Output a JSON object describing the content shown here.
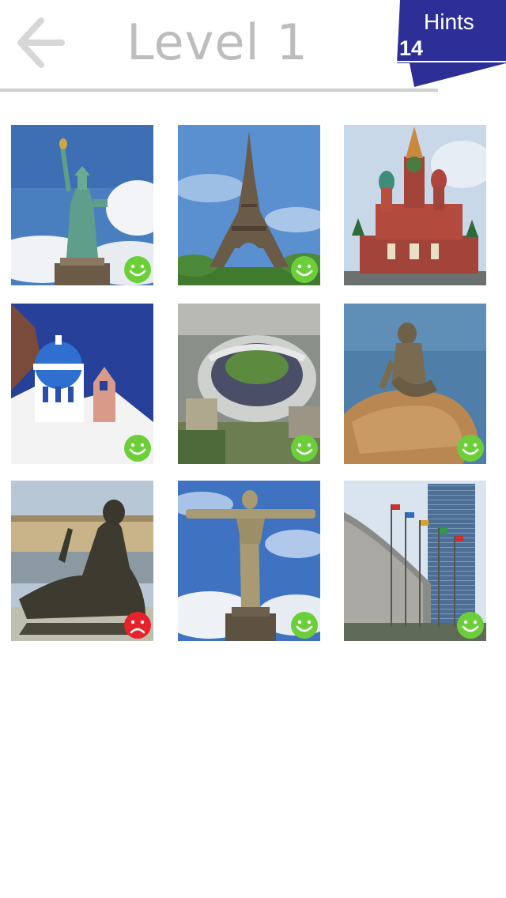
{
  "header": {
    "title": "Level 1",
    "hints_label": "Hints",
    "hints_count": "14"
  },
  "colors": {
    "hints_bg": "#2e2f96",
    "correct": "#6ccf3a",
    "wrong": "#e8222a",
    "title": "#bdbdbd"
  },
  "tiles": [
    {
      "name": "statue-of-liberty",
      "status": "correct"
    },
    {
      "name": "eiffel-tower",
      "status": "correct"
    },
    {
      "name": "saint-basils-cathedral",
      "status": "none"
    },
    {
      "name": "santorini-church",
      "status": "correct"
    },
    {
      "name": "yankee-stadium",
      "status": "correct"
    },
    {
      "name": "little-mermaid",
      "status": "correct"
    },
    {
      "name": "versailles-statue",
      "status": "wrong"
    },
    {
      "name": "christ-the-redeemer",
      "status": "correct"
    },
    {
      "name": "un-headquarters",
      "status": "correct"
    }
  ]
}
